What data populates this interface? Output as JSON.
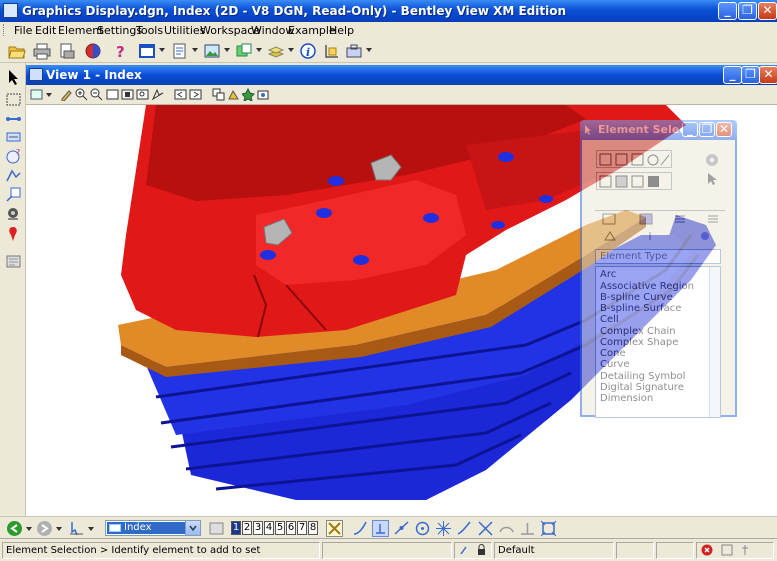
{
  "window": {
    "title": "Graphics Display.dgn, Index (2D - V8 DGN, Read-Only) - Bentley View XM Edition",
    "controls": [
      "minimize-icon",
      "restore-icon",
      "close-icon"
    ]
  },
  "menu": {
    "items": [
      {
        "label": "File"
      },
      {
        "label": "Edit"
      },
      {
        "label": "Element"
      },
      {
        "label": "Settings"
      },
      {
        "label": "Tools"
      },
      {
        "label": "Utilities"
      },
      {
        "label": "Workspace"
      },
      {
        "label": "Window"
      },
      {
        "label": "Example"
      },
      {
        "label": "Help"
      }
    ]
  },
  "view": {
    "title": "View 1 - Index"
  },
  "dialog": {
    "title": "Element Select...",
    "list_header": "Element Type",
    "items": [
      "Arc",
      "Associative Region",
      "B-spline Curve",
      "B-spline Surface",
      "Cell",
      "Complex Chain",
      "Complex Shape",
      "Cone",
      "Curve",
      "Detailing Symbol",
      "Digital Signature",
      "Dimension"
    ]
  },
  "bottombar": {
    "level": "Index",
    "view_numbers": [
      "1",
      "2",
      "3",
      "4",
      "5",
      "6",
      "7",
      "8"
    ]
  },
  "status": {
    "message": "Element Selection > Identify element to add to set",
    "level": "Default"
  },
  "colors": {
    "titlebar": "#0a4fd6",
    "model_red": "#e01818",
    "model_blue": "#1c28d8",
    "model_orange": "#e08a28",
    "selection_blue": "#316ac5"
  }
}
